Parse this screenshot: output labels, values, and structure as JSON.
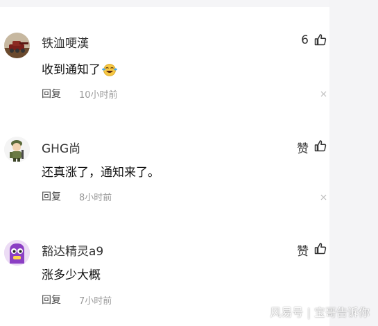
{
  "comments": [
    {
      "username": "铁洫哽漢",
      "text": "收到通知了",
      "like_label": "6",
      "reply_label": "回复",
      "time": "10小时前",
      "avatar_icon": "tank-avatar",
      "emoji_icon": "laughing-crying-emoji"
    },
    {
      "username": "GHG尚",
      "text": "还真涨了，通知来了。",
      "like_label": "赞",
      "reply_label": "回复",
      "time": "8小时前",
      "avatar_icon": "cartoon-soldier-avatar"
    },
    {
      "username": "豁达精灵a9",
      "text": "涨多少大概",
      "like_label": "赞",
      "reply_label": "回复",
      "time": "7小时前",
      "avatar_icon": "purple-monster-avatar"
    }
  ],
  "watermark": "风易号 | 宝哥告诉你"
}
